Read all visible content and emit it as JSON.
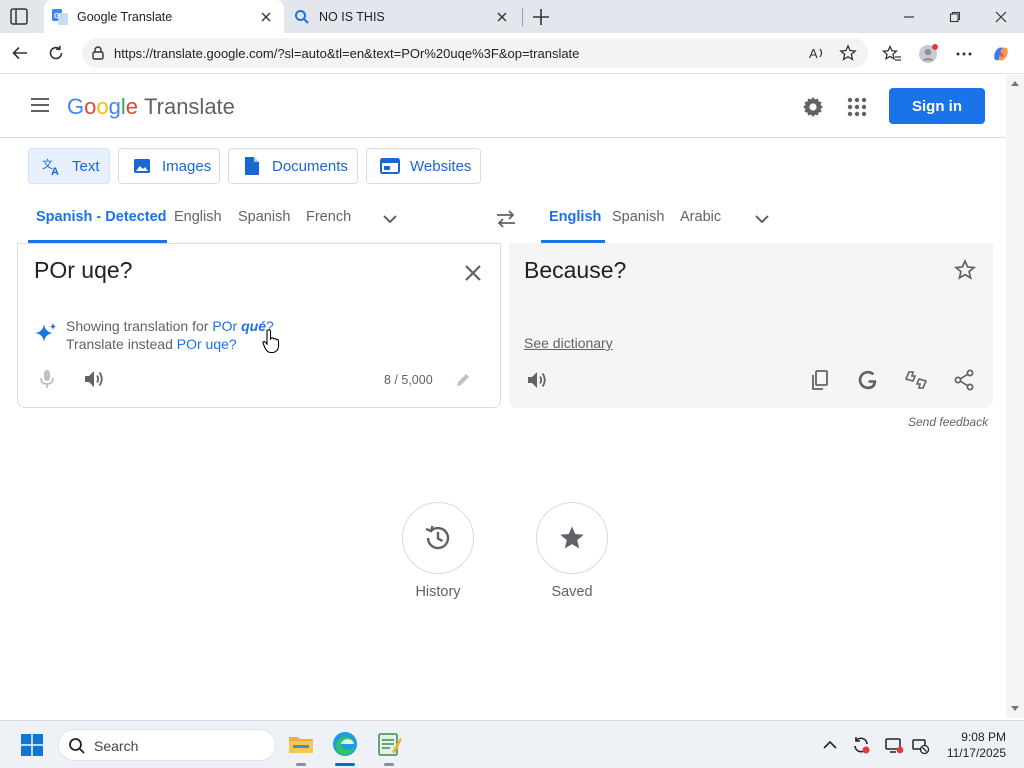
{
  "browser": {
    "tabs": [
      {
        "title": "Google Translate",
        "active": true
      },
      {
        "title": "NO IS THIS",
        "active": false
      }
    ],
    "url": "https://translate.google.com/?sl=auto&tl=en&text=POr%20uqe%3F&op=translate"
  },
  "header": {
    "logo_letters": [
      "G",
      "o",
      "o",
      "g",
      "l",
      "e"
    ],
    "product": "Translate",
    "signin_label": "Sign in"
  },
  "modes": [
    {
      "label": "Text",
      "icon": "translate-icon",
      "active": true
    },
    {
      "label": "Images",
      "icon": "image-icon",
      "active": false
    },
    {
      "label": "Documents",
      "icon": "document-icon",
      "active": false
    },
    {
      "label": "Websites",
      "icon": "website-icon",
      "active": false
    }
  ],
  "source_langs": [
    "Spanish - Detected",
    "English",
    "Spanish",
    "French"
  ],
  "target_langs": [
    "English",
    "Spanish",
    "Arabic"
  ],
  "source": {
    "text": "POr uqe?",
    "showing_prefix": "Showing translation for",
    "showing_link_plain": "POr ",
    "showing_link_bold": "qué",
    "showing_link_tail": "?",
    "instead_prefix": "Translate instead",
    "instead_link": "POr uqe?",
    "char_count": "8 / 5,000"
  },
  "target": {
    "text": "Because?",
    "see_dictionary": "See dictionary"
  },
  "feedback": "Send feedback",
  "bottom": {
    "history": "History",
    "saved": "Saved"
  },
  "taskbar": {
    "search_placeholder": "Search",
    "time": "9:08 PM",
    "date": "11/17/2025"
  },
  "colors": {
    "accent": "#1a73e8",
    "accent_bg": "#e8f0fe",
    "text_muted": "#5f6368"
  }
}
